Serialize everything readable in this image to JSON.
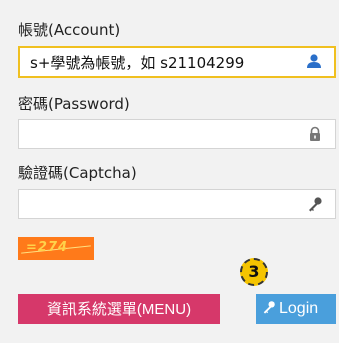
{
  "form": {
    "account": {
      "label": "帳號(Account)",
      "value": "s+學號為帳號，如 s21104299",
      "icon": "user-icon"
    },
    "password": {
      "label": "密碼(Password)",
      "value": "",
      "icon": "lock-icon"
    },
    "captcha": {
      "label": "驗證碼(Captcha)",
      "value": "",
      "icon": "key-icon",
      "image_text": "=274"
    },
    "step_badge": "3",
    "menu_button": "資訊系統選單(MENU)",
    "login_button": "Login"
  },
  "colors": {
    "active_border": "#f0c020",
    "captcha_bg": "#ff7a1a",
    "badge": "#f5c400",
    "menu_button": "#d6386a",
    "login_button": "#4a9fdc",
    "icon_blue": "#2a6fc9"
  }
}
